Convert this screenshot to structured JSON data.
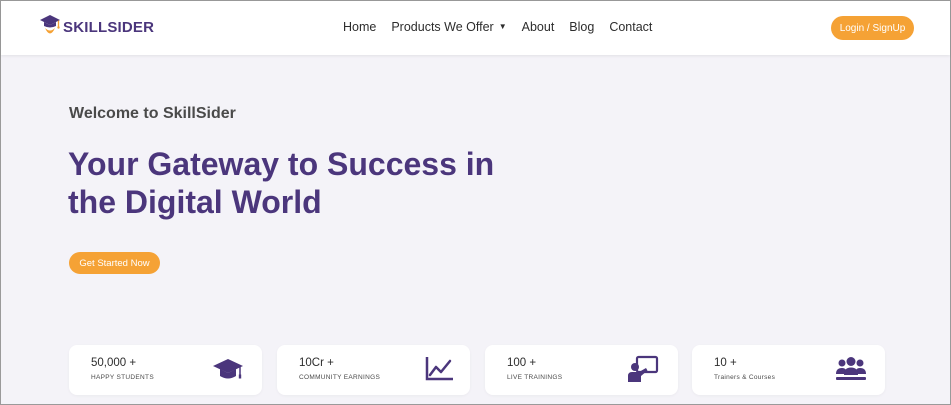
{
  "brand": {
    "name": "SKILLSIDER"
  },
  "nav": {
    "items": [
      {
        "label": "Home"
      },
      {
        "label": "Products We Offer",
        "has_dropdown": true
      },
      {
        "label": "About"
      },
      {
        "label": "Blog"
      },
      {
        "label": "Contact"
      }
    ],
    "login_label": "Login / SignUp"
  },
  "hero": {
    "welcome": "Welcome to SkillSider",
    "headline_line1": "Your Gateway to Success in",
    "headline_line2": "the Digital World",
    "cta_label": "Get Started Now"
  },
  "stats": [
    {
      "value": "50,000 +",
      "label": "HAPPY STUDENTS",
      "icon": "graduation-cap-icon"
    },
    {
      "value": "10Cr +",
      "label": "COMMUNITY EARNINGS",
      "icon": "line-chart-icon"
    },
    {
      "value": "100 +",
      "label": "LIVE TRAININGS",
      "icon": "presenter-icon"
    },
    {
      "value": "10 +",
      "label": "Trainers & Courses",
      "icon": "users-group-icon"
    }
  ],
  "colors": {
    "brand_purple": "#4b367c",
    "accent_orange": "#f5a235",
    "background": "#f4f3f8"
  }
}
